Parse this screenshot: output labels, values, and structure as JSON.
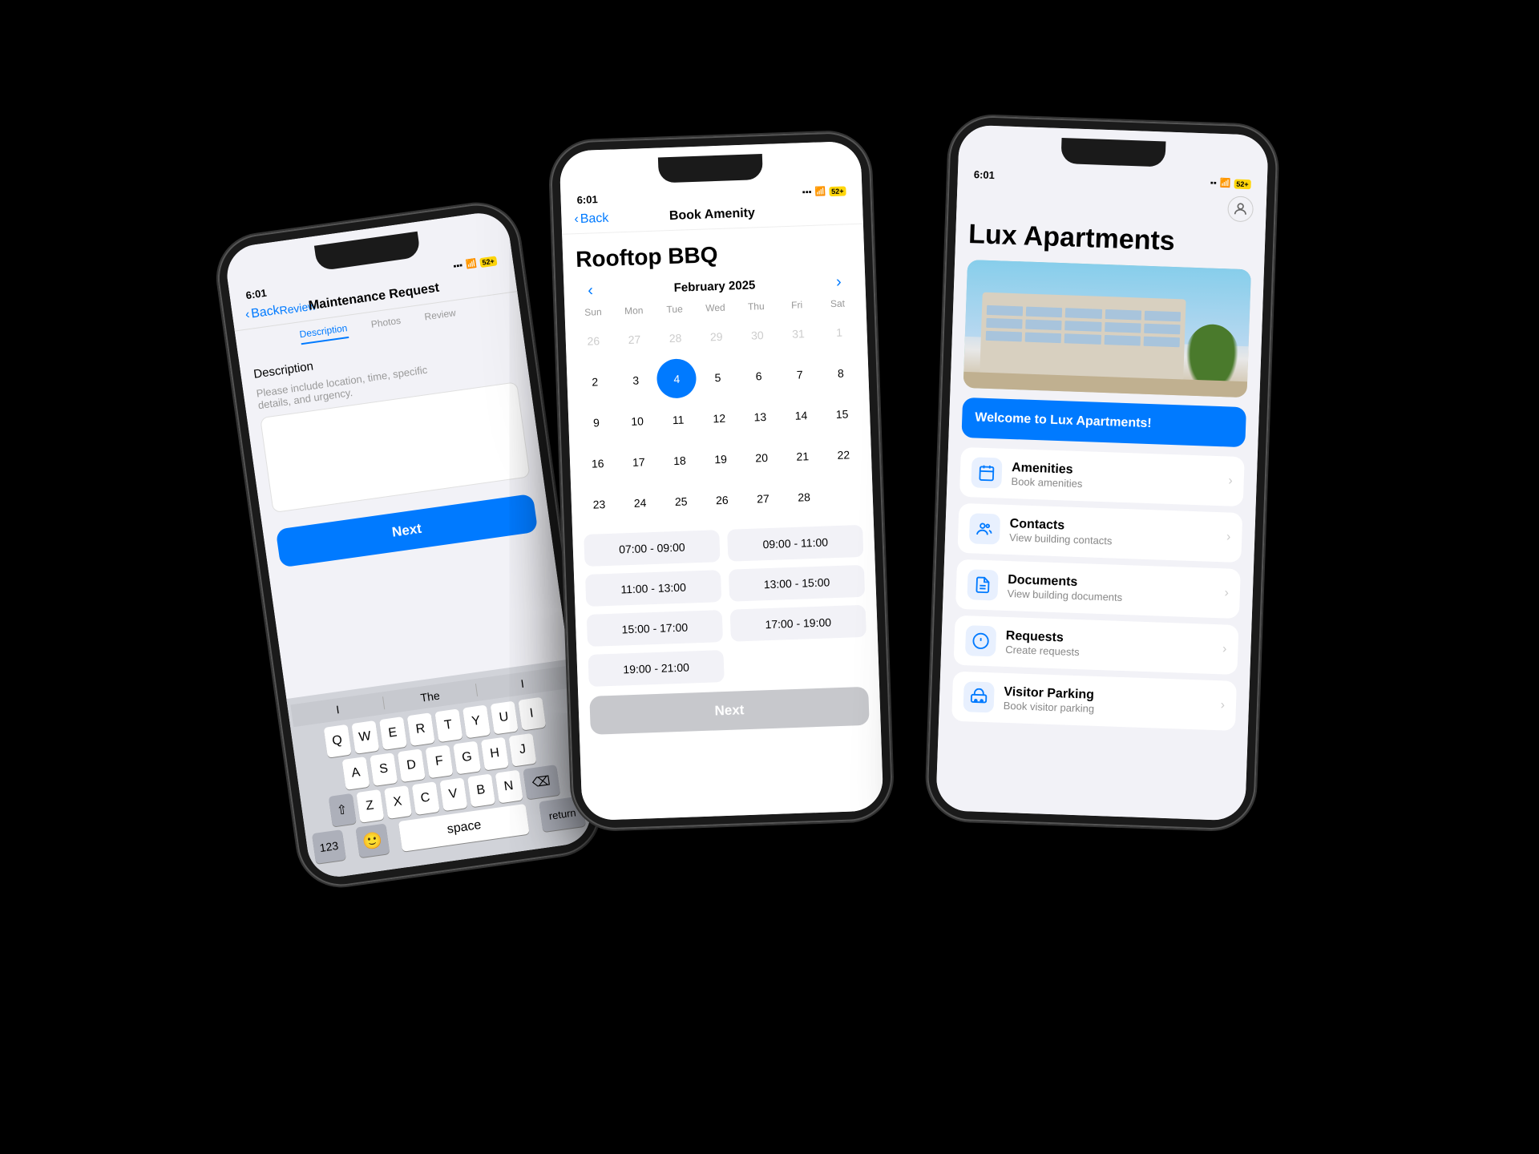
{
  "phone_left": {
    "status_time": "6:01",
    "title": "Maintenance Request",
    "back_label": "Back",
    "steps": [
      "Description",
      "Photos",
      "Review"
    ],
    "form_label": "Description",
    "form_hint": "Please include location, time, specific\ndetails, and urgency.",
    "next_btn": "Next",
    "keyboard": {
      "suggestion_left": "I",
      "suggestion_center": "The",
      "suggestion_right": "I",
      "rows": [
        [
          "Q",
          "W",
          "E",
          "R",
          "T",
          "Y",
          "U",
          "I"
        ],
        [
          "A",
          "S",
          "D",
          "F",
          "G",
          "H",
          "J"
        ],
        [
          "Z",
          "X",
          "C",
          "V",
          "B",
          "N"
        ],
        [
          "space",
          "return"
        ]
      ]
    }
  },
  "phone_mid": {
    "status_time": "6:01",
    "back_label": "Back",
    "nav_title": "Book Amenity",
    "heading": "Rooftop BBQ",
    "calendar": {
      "month_year": "February 2025",
      "days": [
        "Sun",
        "Mon",
        "Tue",
        "Wed",
        "Thu",
        "Fri",
        "Sat"
      ],
      "weeks": [
        [
          "26",
          "27",
          "28",
          "29",
          "30",
          "31",
          "1"
        ],
        [
          "2",
          "3",
          "4",
          "5",
          "6",
          "7",
          "8"
        ],
        [
          "9",
          "10",
          "11",
          "12",
          "13",
          "14",
          "15"
        ],
        [
          "16",
          "17",
          "18",
          "19",
          "20",
          "21",
          "22"
        ],
        [
          "23",
          "24",
          "25",
          "26",
          "27",
          "28",
          ""
        ]
      ],
      "today": "4",
      "other_month": [
        "26",
        "27",
        "28",
        "29",
        "30",
        "31",
        "1"
      ]
    },
    "time_slots": [
      "07:00 - 09:00",
      "09:00 - 11:00",
      "11:00 - 13:00",
      "13:00 - 15:00",
      "15:00 - 17:00",
      "17:00 - 19:00",
      "19:00 - 21:00"
    ],
    "next_btn": "Next"
  },
  "phone_right": {
    "status_time": "6:01",
    "app_title": "Lux Apartments",
    "welcome_msg": "Welcome to Lux Apartments!",
    "menu_items": [
      {
        "id": "amenities",
        "title": "Amenities",
        "subtitle": "Book amenities",
        "icon": "📅"
      },
      {
        "id": "contacts",
        "title": "Contacts",
        "subtitle": "View building contacts",
        "icon": "👥"
      },
      {
        "id": "documents",
        "title": "Documents",
        "subtitle": "View building documents",
        "icon": "📄"
      },
      {
        "id": "requests",
        "title": "Requests",
        "subtitle": "Create requests",
        "icon": "❓"
      },
      {
        "id": "visitor-parking",
        "title": "Visitor Parking",
        "subtitle": "Book visitor parking",
        "icon": "🚗"
      }
    ]
  }
}
